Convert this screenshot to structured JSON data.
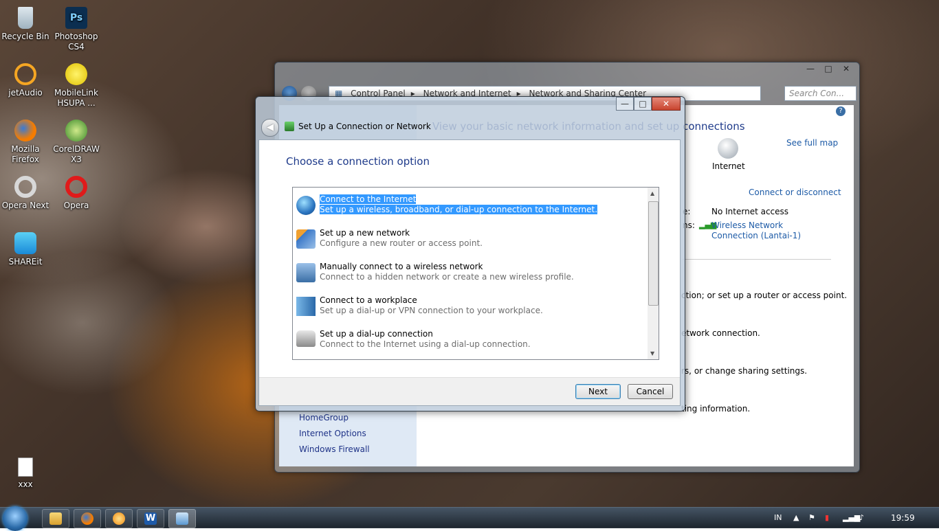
{
  "desktop": {
    "icons": [
      {
        "label": "Recycle Bin"
      },
      {
        "label": "Photoshop CS4"
      },
      {
        "label": "jetAudio"
      },
      {
        "label": "MobileLink HSUPA ..."
      },
      {
        "label": "Mozilla Firefox"
      },
      {
        "label": "CorelDRAW X3"
      },
      {
        "label": "Opera Next"
      },
      {
        "label": "Opera"
      },
      {
        "label": "SHAREit"
      },
      {
        "label": "xxx"
      }
    ]
  },
  "bg_window": {
    "breadcrumb": [
      "Control Panel",
      "Network and Internet",
      "Network and Sharing Center"
    ],
    "search_placeholder": "Search Con...",
    "heading": "View your basic network information and set up connections",
    "see_full_map": "See full map",
    "internet_label": "Internet",
    "connect_or_disconnect": "Connect or disconnect",
    "access_type_label": "e:",
    "access_type_value": "No Internet access",
    "connections_label": "ns:",
    "connection_name": "Wireless Network Connection (Lantai-1)",
    "text_router": "ction; or set up a router or access point.",
    "text_network": "etwork connection.",
    "text_sharing": "rs, or change sharing settings.",
    "text_troubleshoot": "ting information.",
    "left_links": [
      "HomeGroup",
      "Internet Options",
      "Windows Firewall"
    ],
    "window_buttons": {
      "minimize": "—",
      "maximize": "□",
      "close": "✕"
    }
  },
  "dialog": {
    "title": "Set Up a Connection or Network",
    "heading": "Choose a connection option",
    "options": [
      {
        "title": "Connect to the Internet",
        "desc": "Set up a wireless, broadband, or dial-up connection to the Internet.",
        "selected": true,
        "icon": "globe-icon"
      },
      {
        "title": "Set up a new network",
        "desc": "Configure a new router or access point.",
        "selected": false,
        "icon": "router-icon"
      },
      {
        "title": "Manually connect to a wireless network",
        "desc": "Connect to a hidden network or create a new wireless profile.",
        "selected": false,
        "icon": "wireless-icon"
      },
      {
        "title": "Connect to a workplace",
        "desc": "Set up a dial-up or VPN connection to your workplace.",
        "selected": false,
        "icon": "workplace-icon"
      },
      {
        "title": "Set up a dial-up connection",
        "desc": "Connect to the Internet using a dial-up connection.",
        "selected": false,
        "icon": "phone-icon"
      }
    ],
    "next_label": "Next",
    "cancel_label": "Cancel",
    "window_buttons": {
      "minimize": "—",
      "maximize": "□",
      "close": "✕"
    }
  },
  "taskbar": {
    "language": "IN",
    "clock": "19:59"
  },
  "colors": {
    "selection": "#3399ff",
    "link": "#1c5aa6",
    "heading": "#1e3a8a"
  }
}
